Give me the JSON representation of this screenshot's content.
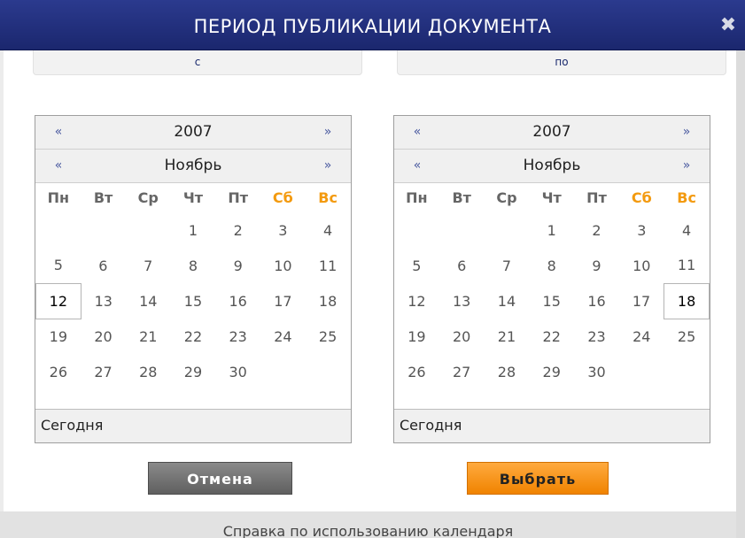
{
  "dialog": {
    "title": "ПЕРИОД ПУБЛИКАЦИИ ДОКУМЕНТА",
    "close_icon": "close-icon"
  },
  "range": {
    "from_label": "с",
    "to_label": "по"
  },
  "calendars": [
    {
      "year": "2007",
      "month": "Ноябрь",
      "prev": "«",
      "next": "»",
      "weekdays": [
        "Пн",
        "Вт",
        "Ср",
        "Чт",
        "Пт",
        "Сб",
        "Вс"
      ],
      "weeks": [
        [
          "",
          "",
          "",
          "1",
          "2",
          "3",
          "4"
        ],
        [
          "5",
          "6",
          "7",
          "8",
          "9",
          "10",
          "11"
        ],
        [
          "12",
          "13",
          "14",
          "15",
          "16",
          "17",
          "18"
        ],
        [
          "19",
          "20",
          "21",
          "22",
          "23",
          "24",
          "25"
        ],
        [
          "26",
          "27",
          "28",
          "29",
          "30",
          "",
          ""
        ]
      ],
      "selected": "12",
      "today_label": "Сегодня"
    },
    {
      "year": "2007",
      "month": "Ноябрь",
      "prev": "«",
      "next": "»",
      "weekdays": [
        "Пн",
        "Вт",
        "Ср",
        "Чт",
        "Пт",
        "Сб",
        "Вс"
      ],
      "weeks": [
        [
          "",
          "",
          "",
          "1",
          "2",
          "3",
          "4"
        ],
        [
          "5",
          "6",
          "7",
          "8",
          "9",
          "10",
          "11"
        ],
        [
          "12",
          "13",
          "14",
          "15",
          "16",
          "17",
          "18"
        ],
        [
          "19",
          "20",
          "21",
          "22",
          "23",
          "24",
          "25"
        ],
        [
          "26",
          "27",
          "28",
          "29",
          "30",
          "",
          ""
        ]
      ],
      "selected": "18",
      "today_label": "Сегодня"
    }
  ],
  "buttons": {
    "cancel": "Отмена",
    "ok": "Выбрать"
  },
  "help_link": "Справка по использованию календаря",
  "colors": {
    "titlebar": "#1f2d7a",
    "weekend": "#f39a0f",
    "ok_button": "#f59010",
    "cancel_button": "#707070"
  }
}
